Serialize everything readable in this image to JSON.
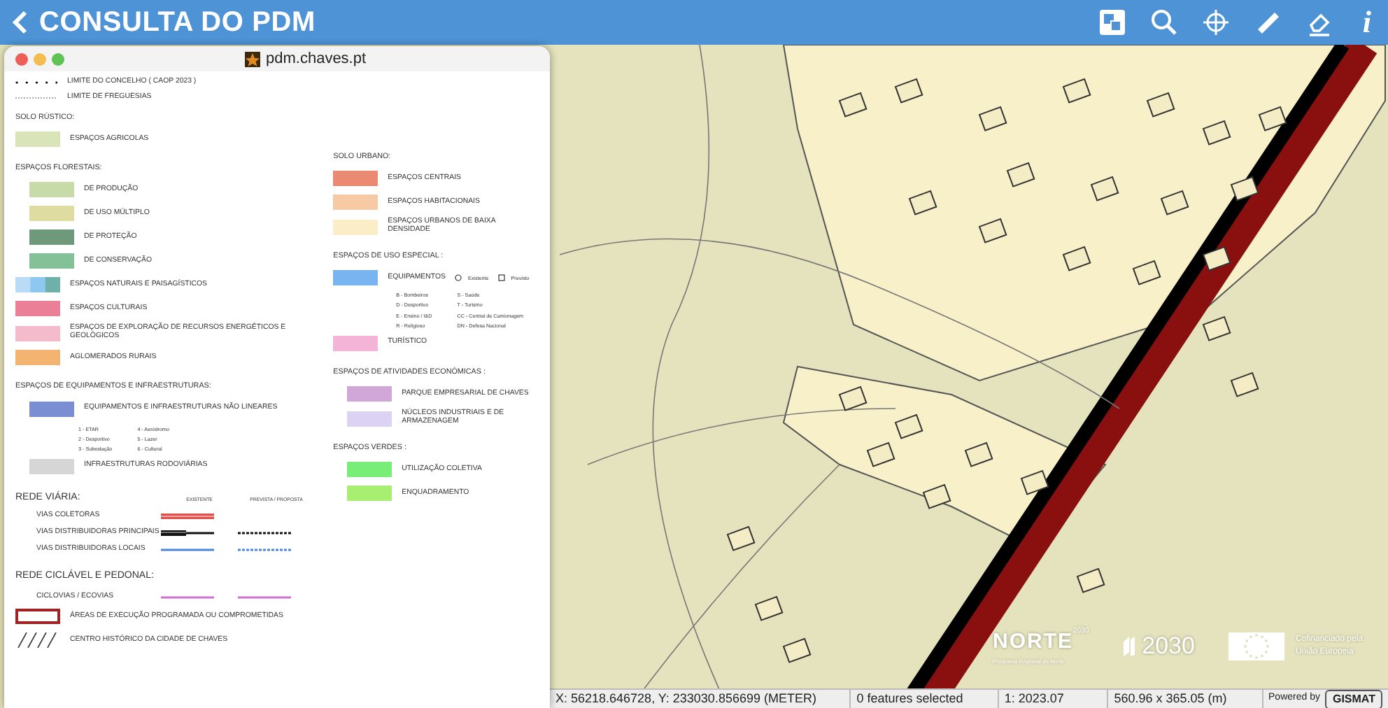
{
  "header": {
    "title": "CONSULTA DO PDM",
    "info_glyph": "i"
  },
  "legend_window": {
    "title": "pdm.chaves.pt",
    "left": [
      {
        "kind": "boundary_dots",
        "label": "LIMITE DO CONCELHO ( CAOP 2023 )"
      },
      {
        "kind": "boundary_dotted",
        "label": "LIMITE DE FREGUESIAS"
      },
      {
        "kind": "heading",
        "text": "SOLO RÚSTICO:"
      },
      {
        "kind": "swatch",
        "label": "ESPAÇOS AGRICOLAS",
        "color": "#d9e5b9"
      },
      {
        "kind": "heading",
        "text": "ESPAÇOS FLORESTAIS:"
      },
      {
        "kind": "sub_swatch",
        "label": "DE PRODUÇÃO",
        "color": "#c6dba7"
      },
      {
        "kind": "sub_swatch",
        "label": "DE USO MÚLTIPLO",
        "color": "#dedca0"
      },
      {
        "kind": "sub_swatch",
        "label": "DE PROTEÇÃO",
        "color": "#6e9a7b"
      },
      {
        "kind": "sub_swatch",
        "label": "DE CONSERVAÇÃO",
        "color": "#84c197"
      },
      {
        "kind": "split",
        "label": "ESPAÇOS NATURAIS E PAISAGÍSTICOS"
      },
      {
        "kind": "swatch",
        "label": "ESPAÇOS CULTURAIS",
        "color": "#ec7f98"
      },
      {
        "kind": "swatch",
        "label": "ESPAÇOS DE EXPLORAÇÃO DE RECURSOS ENERGÉTICOS E GEOLÓGICOS",
        "color": "#f4bccb"
      },
      {
        "kind": "swatch",
        "label": "AGLOMERADOS RURAIS",
        "color": "#f2b470"
      },
      {
        "kind": "heading",
        "text": "ESPAÇOS DE EQUIPAMENTOS E INFRAESTRUTURAS:"
      },
      {
        "kind": "sub_swatch",
        "label": "EQUIPAMENTOS E INFRAESTRUTURAS NÃO LINEARES",
        "color": "#7a8ed4"
      },
      {
        "kind": "codes",
        "columns": [
          [
            "1 - ETAR",
            "2 - Desportivo",
            "3 - Subestação"
          ],
          [
            "4 - Aeródromo",
            "5 - Lazer",
            "6 - Cultural"
          ]
        ]
      },
      {
        "kind": "sub_swatch",
        "label": "INFRAESTRUTURAS RODOVIÁRIAS",
        "color": "#d6d6d6"
      },
      {
        "kind": "road_header",
        "text": "REDE VIÁRIA:",
        "columns": [
          "EXISTENTE",
          "PREVISTA / PROPOSTA"
        ]
      },
      {
        "kind": "collector_road",
        "label": "VIAS COLETORAS",
        "color": "#e0504c"
      },
      {
        "kind": "main_road",
        "label": "VIAS DISTRIBUIDORAS PRINCIPAIS",
        "color": "#111111"
      },
      {
        "kind": "local_road",
        "label": "VIAS DISTRIBUIDORAS LOCAIS",
        "color": "#4a86d8"
      },
      {
        "kind": "major_heading",
        "text": "REDE CICLÁVEL E PEDONAL:"
      },
      {
        "kind": "cycle_path",
        "label": "CICLOVIAS / ECOVIAS",
        "color": "#d070d0"
      },
      {
        "kind": "outline",
        "label": "ÁREAS DE EXECUÇÃO PROGRAMADA OU COMPROMETIDAS",
        "color": "#a02222"
      },
      {
        "kind": "hatch",
        "label": "CENTRO HISTÓRICO DA CIDADE DE CHAVES"
      }
    ],
    "right": [
      {
        "kind": "heading",
        "text": "SOLO URBANO:"
      },
      {
        "kind": "swatch",
        "label": "ESPAÇOS CENTRAIS",
        "color": "#eb8a72"
      },
      {
        "kind": "swatch",
        "label": "ESPAÇOS HABITACIONAIS",
        "color": "#f5caa5"
      },
      {
        "kind": "swatch",
        "label": "ESPAÇOS URBANOS DE BAIXA DENSIDADE",
        "color": "#fbedc8"
      },
      {
        "kind": "heading",
        "text": "ESPAÇOS DE USO ESPECIAL :"
      },
      {
        "kind": "equip",
        "label": "EQUIPAMENTOS",
        "color": "#7ab4f0",
        "options": [
          "Existente",
          "Previsto"
        ]
      },
      {
        "kind": "codes",
        "columns": [
          [
            "B - Bombeiros",
            "D - Desportivo",
            "E - Ensino / I&D",
            "R - Religioso"
          ],
          [
            "S - Saúde",
            "T - Turismo",
            "CC - Central de Camionagem",
            "DN - Defesa Nacional"
          ]
        ]
      },
      {
        "kind": "swatch",
        "label": "TURÍSTICO",
        "color": "#f4b4d8"
      },
      {
        "kind": "heading",
        "text": "ESPAÇOS DE ATIVIDADES ECONÓMICAS :"
      },
      {
        "kind": "sub_swatch",
        "label": "PARQUE EMPRESARIAL DE CHAVES",
        "color": "#d0a8d8"
      },
      {
        "kind": "sub_swatch",
        "label": "NÚCLEOS INDUSTRIAIS E DE ARMAZENAGEM",
        "color": "#dcd2f4"
      },
      {
        "kind": "heading",
        "text": "ESPAÇOS VERDES :"
      },
      {
        "kind": "sub_swatch",
        "label": "UTILIZAÇÃO COLETIVA",
        "color": "#78ee78"
      },
      {
        "kind": "sub_swatch",
        "label": "ENQUADRAMENTO",
        "color": "#a8ee70"
      }
    ]
  },
  "logos": {
    "norte": "NORTE",
    "norte_year": "2030",
    "norte_sub": "Programa Regional do Norte",
    "year": "2030",
    "eu_line1": "Cofinanciado pela",
    "eu_line2": "União Europeia"
  },
  "status_bar": {
    "coordinates": "X: 56218.646728, Y: 233030.856699 (METER)",
    "selection": "0 features selected",
    "scale": "1: 2023.07",
    "extent": "560.96 x 365.05 (m)",
    "powered_by": "Powered by",
    "brand": "GISMAT"
  }
}
